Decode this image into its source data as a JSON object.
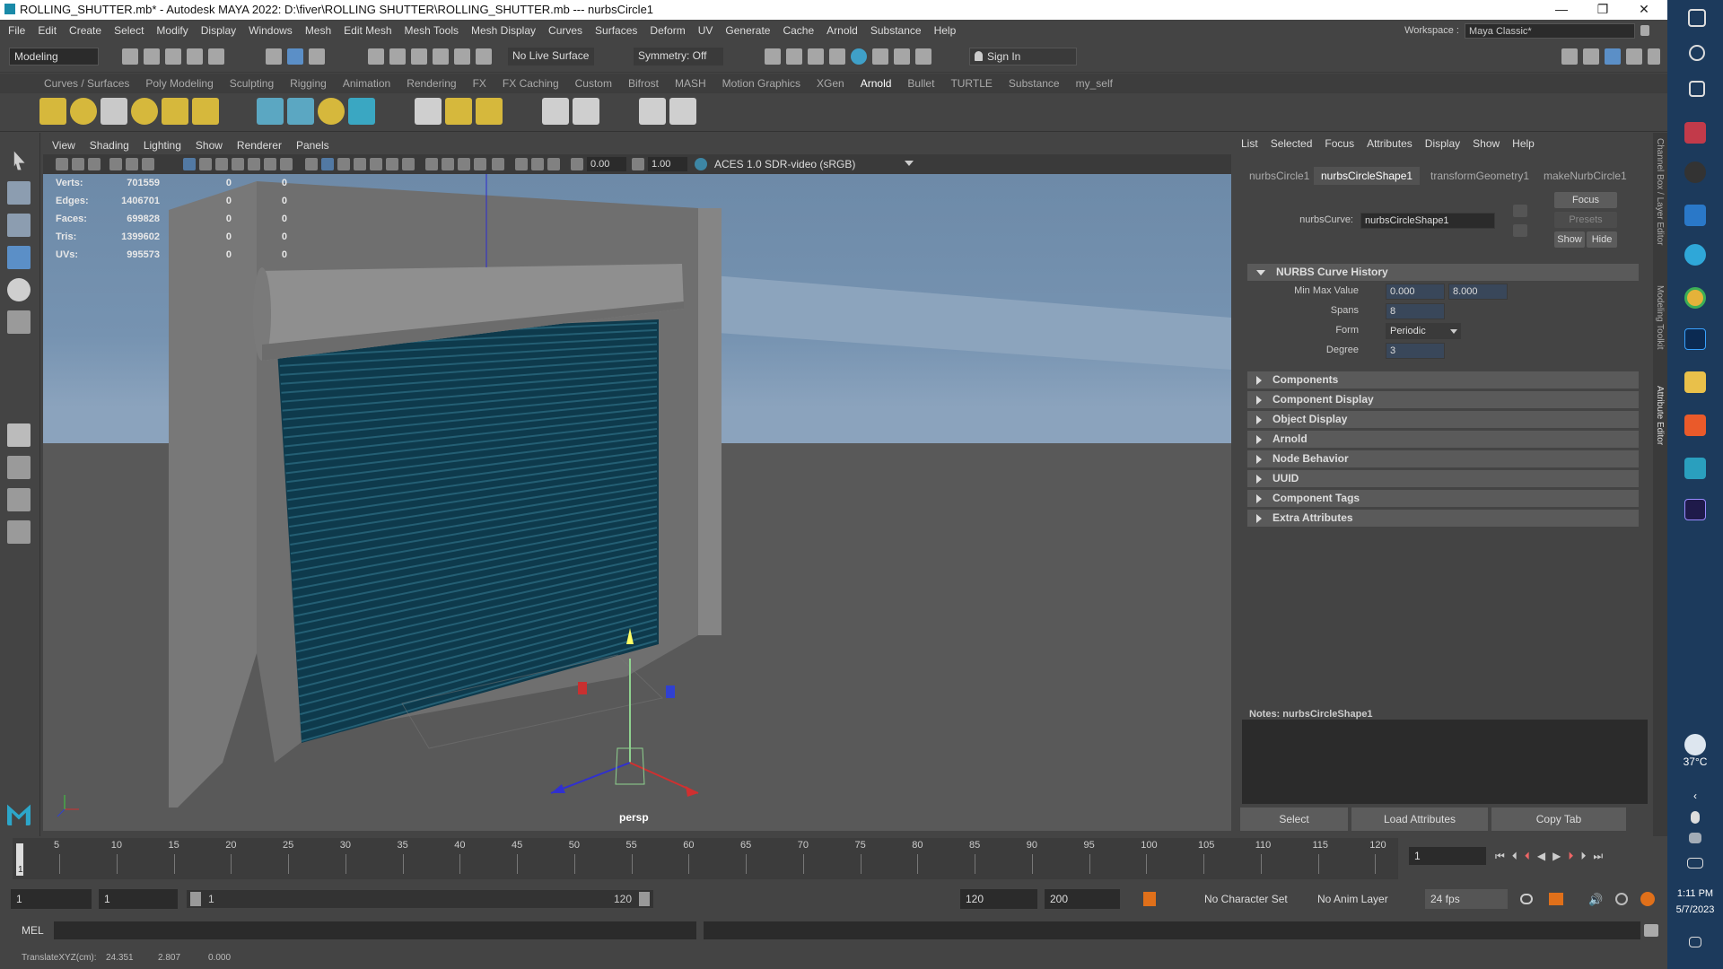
{
  "window": {
    "title": "ROLLING_SHUTTER.mb* - Autodesk MAYA 2022: D:\\fiver\\ROLLING SHUTTER\\ROLLING_SHUTTER.mb  ---  nurbsCircle1",
    "minimize": "—",
    "maximize": "❐",
    "close": "✕"
  },
  "menubar": {
    "items": [
      "File",
      "Edit",
      "Create",
      "Select",
      "Modify",
      "Display",
      "Windows",
      "Mesh",
      "Edit Mesh",
      "Mesh Tools",
      "Mesh Display",
      "Curves",
      "Surfaces",
      "Deform",
      "UV",
      "Generate",
      "Cache",
      "Arnold",
      "Substance",
      "Help"
    ],
    "workspace_label": "Workspace :",
    "workspace_value": "Maya Classic*"
  },
  "statusline": {
    "mode": "Modeling",
    "live_surface": "No Live Surface",
    "symmetry": "Symmetry: Off",
    "sign_in": "Sign In"
  },
  "shelf": {
    "tabs": [
      "Curves / Surfaces",
      "Poly Modeling",
      "Sculpting",
      "Rigging",
      "Animation",
      "Rendering",
      "FX",
      "FX Caching",
      "Custom",
      "Bifrost",
      "MASH",
      "Motion Graphics",
      "XGen",
      "Arnold",
      "Bullet",
      "TURTLE",
      "Substance",
      "my_self"
    ],
    "active_tab": "Arnold"
  },
  "viewport": {
    "menu": [
      "View",
      "Shading",
      "Lighting",
      "Show",
      "Renderer",
      "Panels"
    ],
    "exposure": "0.00",
    "gamma": "1.00",
    "color_space": "ACES 1.0 SDR-video (sRGB)",
    "camera": "persp",
    "hud": [
      {
        "label": "Verts:",
        "a": "701559",
        "b": "0",
        "c": "0"
      },
      {
        "label": "Edges:",
        "a": "1406701",
        "b": "0",
        "c": "0"
      },
      {
        "label": "Faces:",
        "a": "699828",
        "b": "0",
        "c": "0"
      },
      {
        "label": "Tris:",
        "a": "1399602",
        "b": "0",
        "c": "0"
      },
      {
        "label": "UVs:",
        "a": "995573",
        "b": "0",
        "c": "0"
      }
    ],
    "colors": {
      "sky": "#7693b1",
      "ground": "#5a5a5a",
      "shutter": "#0e3a4c",
      "wall": "#727272"
    }
  },
  "attribute_editor": {
    "menu": [
      "List",
      "Selected",
      "Focus",
      "Attributes",
      "Display",
      "Show",
      "Help"
    ],
    "tabs": [
      "nurbsCircle1",
      "nurbsCircleShape1",
      "transformGeometry1",
      "makeNurbCircle1"
    ],
    "active_tab": "nurbsCircleShape1",
    "node_type_label": "nurbsCurve:",
    "node_name": "nurbsCircleShape1",
    "focus_btn": "Focus",
    "presets_btn": "Presets",
    "show_btn": "Show",
    "hide_btn": "Hide",
    "open_section": "NURBS Curve History",
    "min_max_label": "Min Max Value",
    "min_value": "0.000",
    "max_value": "8.000",
    "spans_label": "Spans",
    "spans_value": "8",
    "form_label": "Form",
    "form_value": "Periodic",
    "degree_label": "Degree",
    "degree_value": "3",
    "sections": [
      "Components",
      "Component Display",
      "Object Display",
      "Arnold",
      "Node Behavior",
      "UUID",
      "Component Tags",
      "Extra Attributes"
    ],
    "notes_label": "Notes:",
    "notes_node": "nurbsCircleShape1",
    "bottom_buttons": [
      "Select",
      "Load Attributes",
      "Copy Tab"
    ],
    "side_labels": [
      "Channel Box / Layer Editor",
      "Modeling Toolkit",
      "Attribute Editor"
    ]
  },
  "timeline": {
    "ticks": [
      "5",
      "10",
      "15",
      "20",
      "25",
      "30",
      "35",
      "40",
      "45",
      "50",
      "55",
      "60",
      "65",
      "70",
      "75",
      "80",
      "85",
      "90",
      "95",
      "100",
      "105",
      "110",
      "115",
      "120"
    ],
    "current_frame_marker": "1",
    "current_frame_field": "1"
  },
  "range": {
    "start": "1",
    "playback_start": "1",
    "slider_start": "1",
    "slider_end": "120",
    "playback_end": "120",
    "end": "200",
    "character_set": "No Character Set",
    "anim_layer": "No Anim Layer",
    "fps": "24 fps"
  },
  "command_line": {
    "language": "MEL"
  },
  "help_line": {
    "label": "TranslateXYZ(cm):",
    "x": "24.351",
    "y": "2.807",
    "z": "0.000"
  },
  "taskbar": {
    "temperature": "37°C",
    "time": "1:11 PM",
    "date": "5/7/2023"
  }
}
